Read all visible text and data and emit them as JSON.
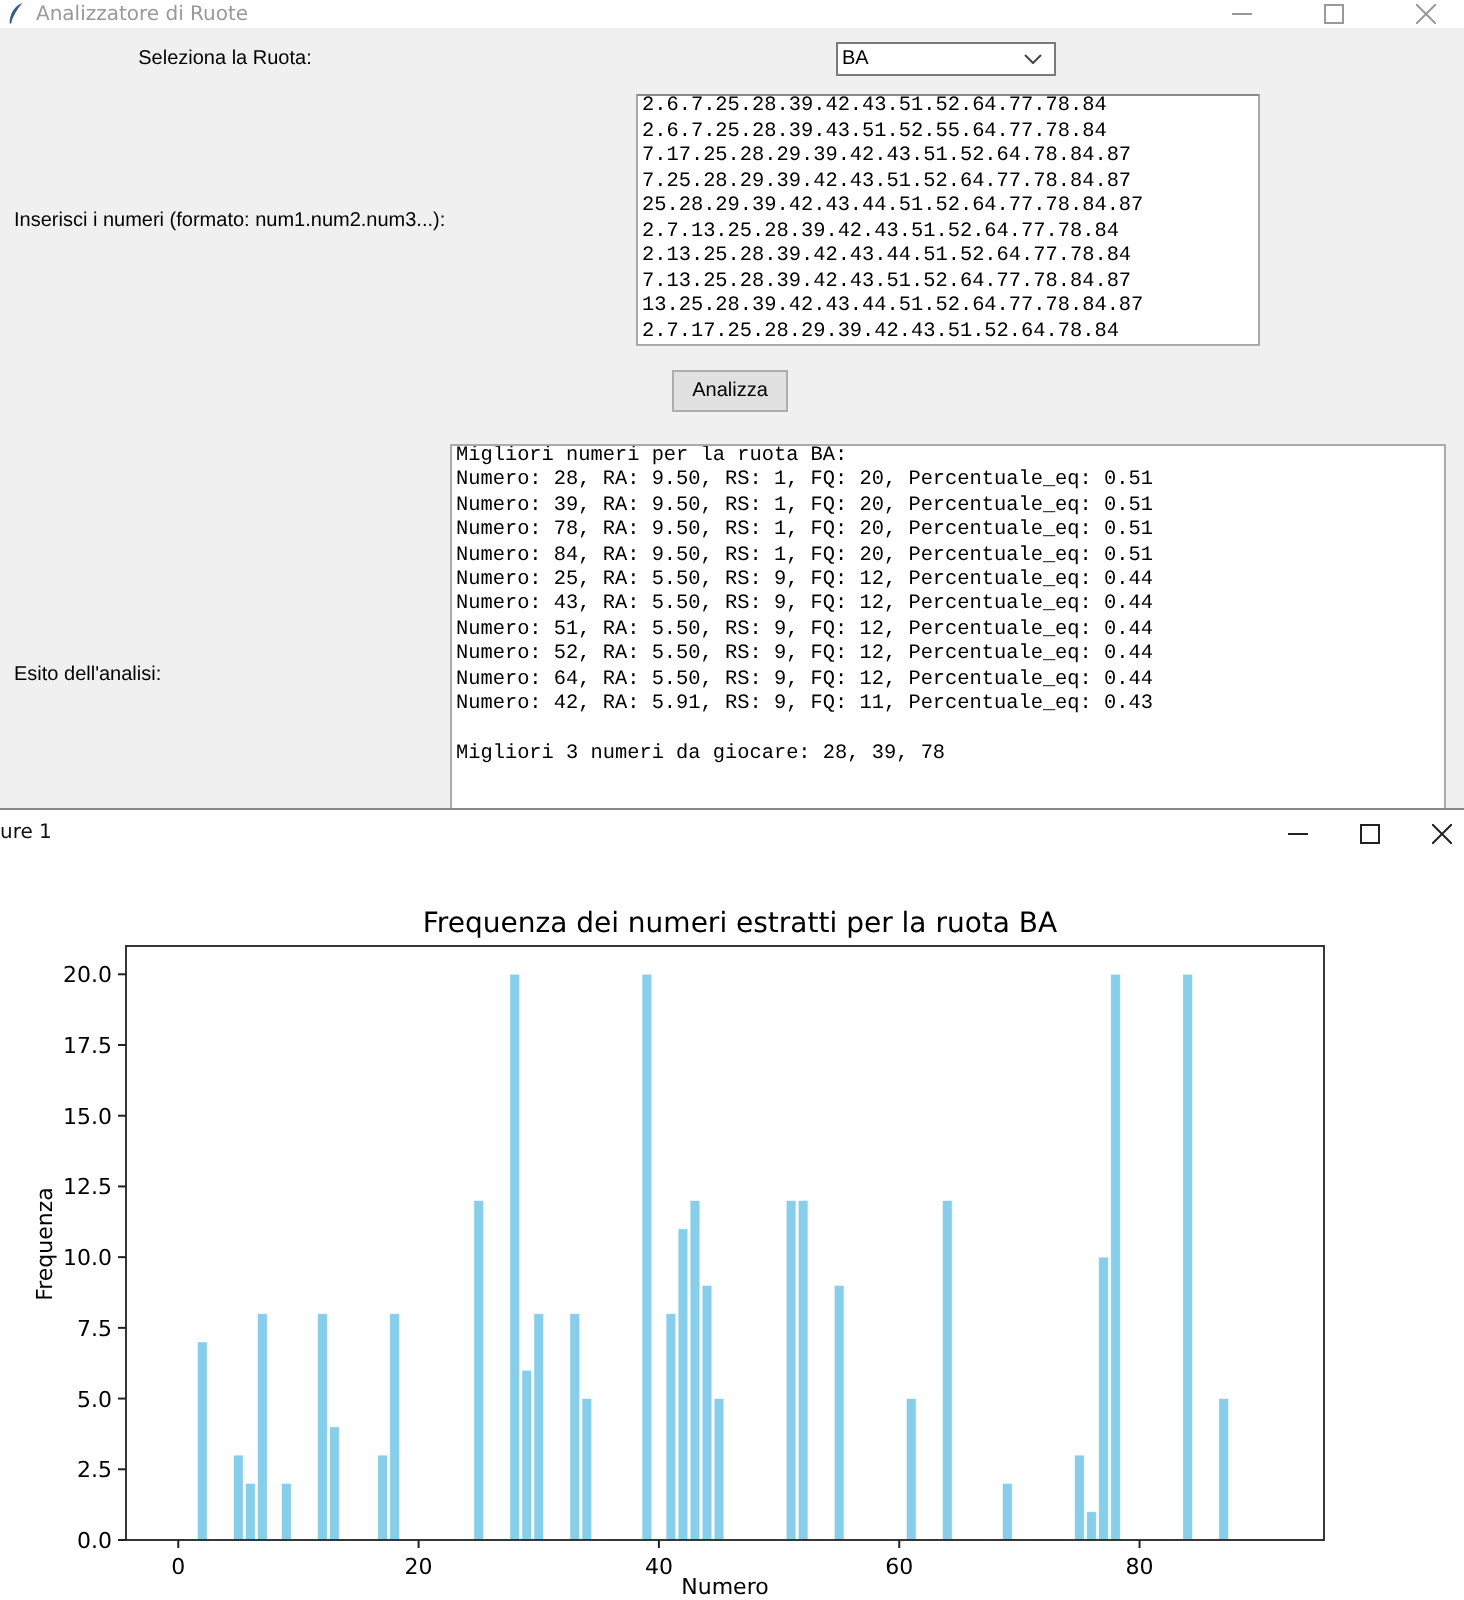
{
  "main_window": {
    "title": "Analizzatore di Ruote",
    "wheel_label": "Seleziona la Ruota:",
    "wheel_select": {
      "value": "BA"
    },
    "numbers_label": "Inserisci i numeri (formato: num1.num2.num3...):",
    "numbers_input": {
      "lines": [
        "2.6.7.25.28.39.42.43.51.52.64.77.78.84",
        "2.6.7.25.28.39.43.51.52.55.64.77.78.84",
        "7.17.25.28.29.39.42.43.51.52.64.78.84.87",
        "7.25.28.29.39.42.43.51.52.64.77.78.84.87",
        "25.28.29.39.42.43.44.51.52.64.77.78.84.87",
        "2.7.13.25.28.39.42.43.51.52.64.77.78.84",
        "2.13.25.28.39.42.43.44.51.52.64.77.78.84",
        "7.13.25.28.39.42.43.51.52.64.77.78.84.87",
        "13.25.28.39.42.43.44.51.52.64.77.78.84.87",
        "2.7.17.25.28.29.39.42.43.51.52.64.78.84"
      ]
    },
    "analyze_button": "Analizza",
    "result_label": "Esito dell'analisi:",
    "result_output": {
      "lines": [
        "Migliori numeri per la ruota BA:",
        "Numero: 28, RA: 9.50, RS: 1, FQ: 20, Percentuale_eq: 0.51",
        "Numero: 39, RA: 9.50, RS: 1, FQ: 20, Percentuale_eq: 0.51",
        "Numero: 78, RA: 9.50, RS: 1, FQ: 20, Percentuale_eq: 0.51",
        "Numero: 84, RA: 9.50, RS: 1, FQ: 20, Percentuale_eq: 0.51",
        "Numero: 25, RA: 5.50, RS: 9, FQ: 12, Percentuale_eq: 0.44",
        "Numero: 43, RA: 5.50, RS: 9, FQ: 12, Percentuale_eq: 0.44",
        "Numero: 51, RA: 5.50, RS: 9, FQ: 12, Percentuale_eq: 0.44",
        "Numero: 52, RA: 5.50, RS: 9, FQ: 12, Percentuale_eq: 0.44",
        "Numero: 64, RA: 5.50, RS: 9, FQ: 12, Percentuale_eq: 0.44",
        "Numero: 42, RA: 5.91, RS: 9, FQ: 11, Percentuale_eq: 0.43"
      ],
      "summary": "Migliori 3 numeri da giocare: 28, 39, 78"
    }
  },
  "figure_window": {
    "title": "ure 1",
    "chart_data": {
      "type": "bar",
      "title": "Frequenza dei numeri estratti per la ruota BA",
      "xlabel": "Numero",
      "ylabel": "Frequenza",
      "x": [
        2,
        5,
        6,
        7,
        9,
        12,
        13,
        17,
        18,
        25,
        28,
        29,
        30,
        33,
        34,
        39,
        41,
        42,
        43,
        44,
        45,
        51,
        52,
        55,
        61,
        64,
        69,
        75,
        76,
        77,
        78,
        84,
        87
      ],
      "values": [
        7,
        3,
        2,
        8,
        2,
        8,
        4,
        3,
        8,
        12,
        20,
        6,
        8,
        8,
        5,
        20,
        8,
        11,
        12,
        9,
        5,
        12,
        12,
        9,
        5,
        12,
        2,
        3,
        1,
        10,
        20,
        20,
        5
      ],
      "color": "#87ceeb",
      "xlim": [
        -4.35,
        95.35
      ],
      "ylim": [
        0,
        21
      ],
      "xticks": [
        0,
        20,
        40,
        60,
        80
      ],
      "yticks": [
        {
          "value": 0,
          "label": "0.0"
        },
        {
          "value": 2.5,
          "label": "2.5"
        },
        {
          "value": 5,
          "label": "5.0"
        },
        {
          "value": 7.5,
          "label": "7.5"
        },
        {
          "value": 10,
          "label": "10.0"
        },
        {
          "value": 12.5,
          "label": "12.5"
        },
        {
          "value": 15,
          "label": "15.0"
        },
        {
          "value": 17.5,
          "label": "17.5"
        },
        {
          "value": 20,
          "label": "20.0"
        }
      ]
    }
  }
}
